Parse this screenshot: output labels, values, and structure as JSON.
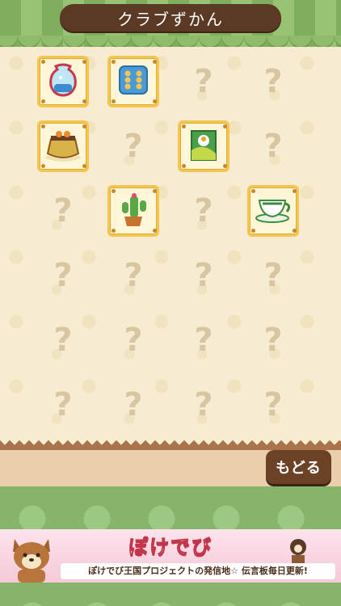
{
  "header": {
    "title": "クラブずかん"
  },
  "grid": {
    "placeholder": "?",
    "slots": [
      {
        "state": "found",
        "icon": "fishbowl-icon"
      },
      {
        "state": "found",
        "icon": "dice-icon"
      },
      {
        "state": "unknown"
      },
      {
        "state": "unknown"
      },
      {
        "state": "found",
        "icon": "kotatsu-icon"
      },
      {
        "state": "unknown"
      },
      {
        "state": "found",
        "icon": "bird-picture-icon"
      },
      {
        "state": "unknown"
      },
      {
        "state": "unknown"
      },
      {
        "state": "found",
        "icon": "cactus-icon"
      },
      {
        "state": "unknown"
      },
      {
        "state": "found",
        "icon": "teacup-icon"
      },
      {
        "state": "unknown"
      },
      {
        "state": "unknown"
      },
      {
        "state": "unknown"
      },
      {
        "state": "unknown"
      },
      {
        "state": "unknown"
      },
      {
        "state": "unknown"
      },
      {
        "state": "unknown"
      },
      {
        "state": "unknown"
      },
      {
        "state": "unknown"
      },
      {
        "state": "unknown"
      },
      {
        "state": "unknown"
      },
      {
        "state": "unknown"
      }
    ]
  },
  "footer": {
    "back_label": "もどる"
  },
  "banner": {
    "title": "ぽけでび",
    "subtitle": "ぽけでび王国プロジェクトの発信地☆ 伝言板毎日更新!"
  },
  "colors": {
    "title_bg": "#5a3a24",
    "card_border": "#f4c64f",
    "awning": "#7fae5e"
  }
}
